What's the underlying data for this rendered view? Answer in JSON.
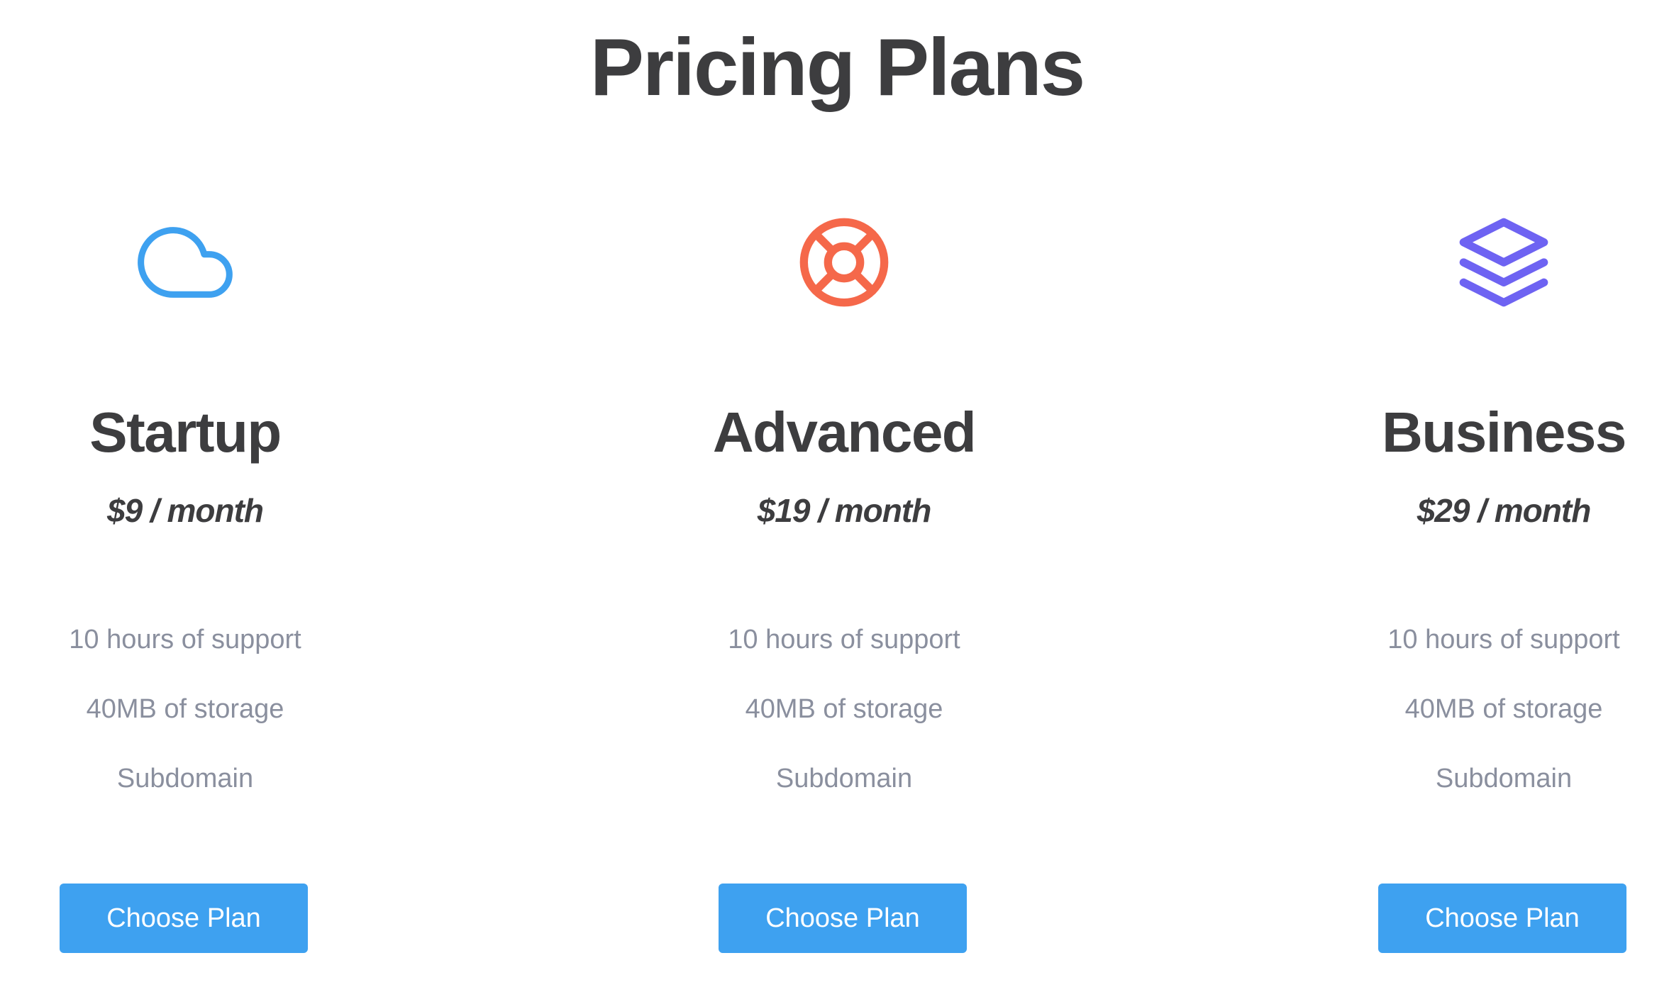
{
  "page": {
    "title": "Pricing Plans"
  },
  "plans": [
    {
      "icon": "cloud-icon",
      "icon_color": "#3ea1f0",
      "name": "Startup",
      "price": "$9 / month",
      "features": [
        "10 hours of support",
        "40MB of storage",
        "Subdomain"
      ],
      "button_label": "Choose Plan"
    },
    {
      "icon": "life-buoy-icon",
      "icon_color": "#f5684a",
      "name": "Advanced",
      "price": "$19 / month",
      "features": [
        "10 hours of support",
        "40MB of storage",
        "Subdomain"
      ],
      "button_label": "Choose Plan"
    },
    {
      "icon": "layers-icon",
      "icon_color": "#6e63f2",
      "name": "Business",
      "price": "$29 / month",
      "features": [
        "10 hours of support",
        "40MB of storage",
        "Subdomain"
      ],
      "button_label": "Choose Plan"
    }
  ],
  "colors": {
    "button_background": "#3ea1f0",
    "heading_text": "#3d3d3f",
    "feature_text": "#8a8f9e"
  }
}
